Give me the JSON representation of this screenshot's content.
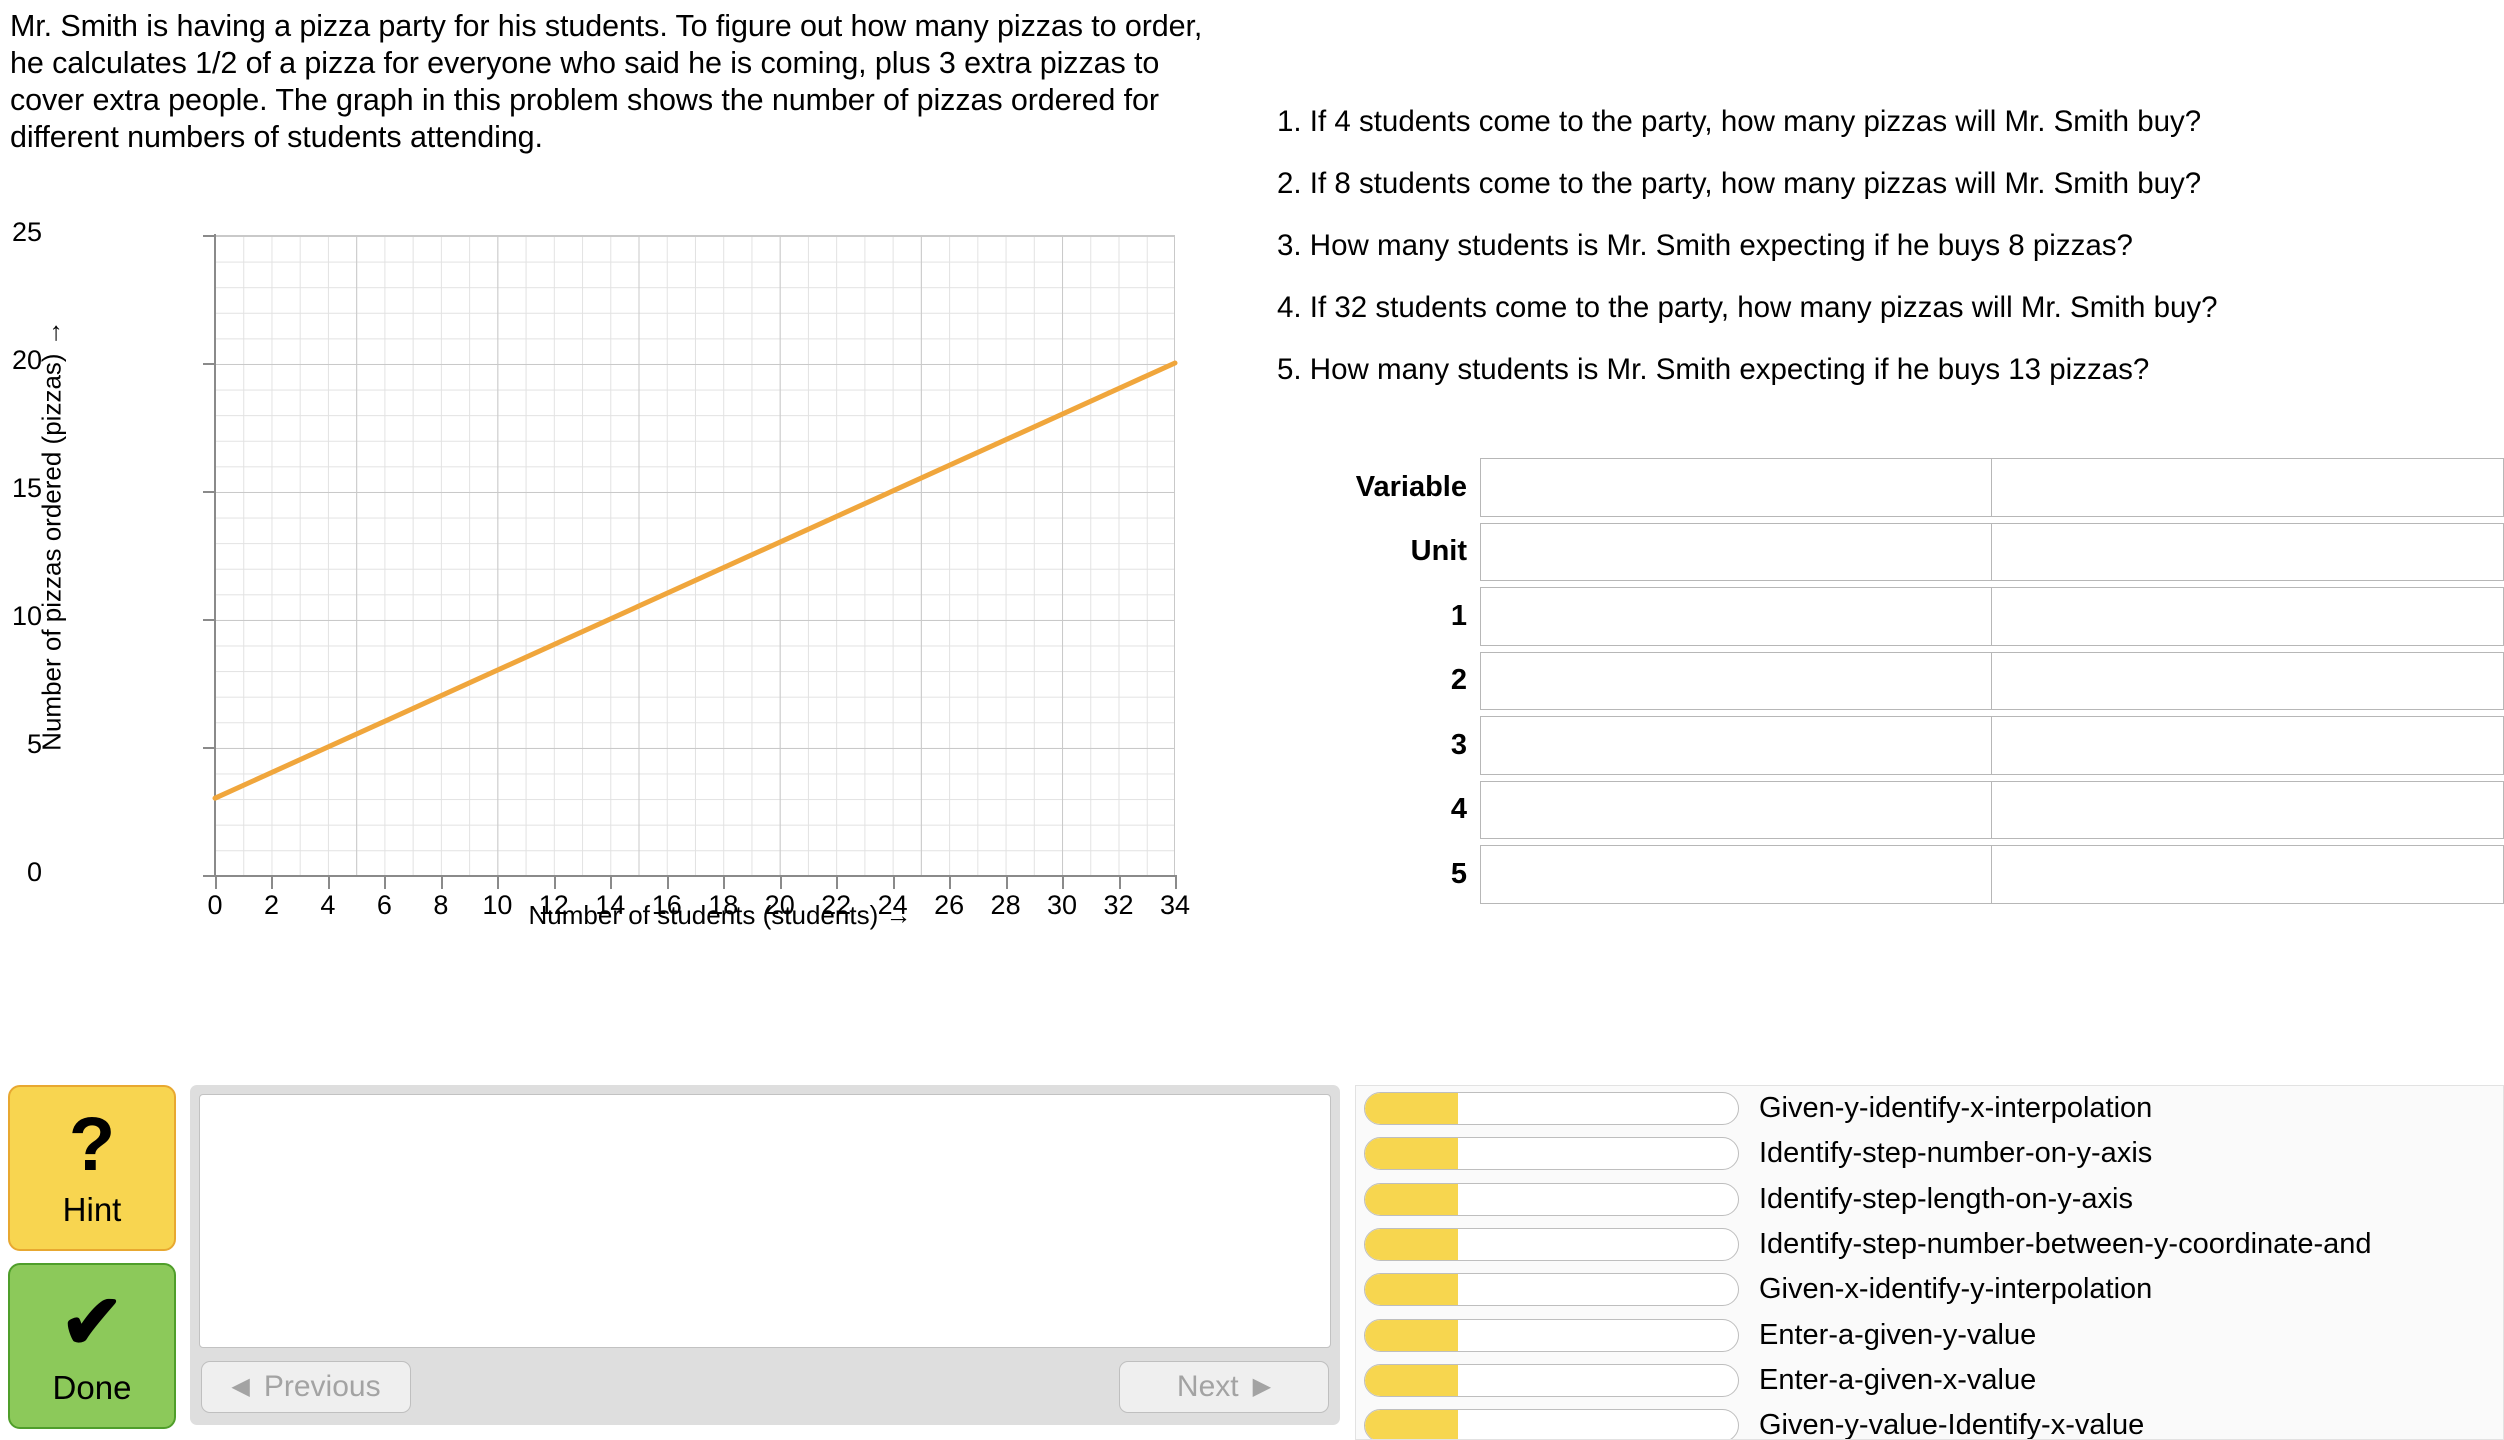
{
  "problem": {
    "statement": "Mr. Smith is having a pizza party for his students. To figure out how many pizzas to order, he calculates 1/2 of a pizza for everyone who said he is coming, plus 3 extra pizzas to cover extra people. The graph in this problem shows the number of pizzas ordered for different numbers of students attending."
  },
  "questions": [
    "1. If 4 students come to the party, how many pizzas will Mr. Smith buy?",
    "2. If 8 students come to the party, how many pizzas will Mr. Smith buy?",
    "3. How many students is Mr. Smith expecting if he buys 8 pizzas?",
    "4. If 32 students come to the party, how many pizzas will Mr. Smith buy?",
    "5. How many students is Mr. Smith expecting if he buys 13 pizzas?"
  ],
  "chart_data": {
    "type": "line",
    "title": "",
    "xlabel": "Number of students (students) →",
    "ylabel": "Number of pizzas ordered (pizzas) →",
    "xlim": [
      0,
      34
    ],
    "ylim": [
      0,
      25
    ],
    "xticks": [
      0,
      2,
      4,
      6,
      8,
      10,
      12,
      14,
      16,
      18,
      20,
      22,
      24,
      26,
      28,
      30,
      32,
      34
    ],
    "yticks": [
      0,
      5,
      10,
      15,
      20,
      25
    ],
    "x_minor_step": 1,
    "y_minor_step": 1,
    "grid": true,
    "legend": "none",
    "line_color": "#F0A63C",
    "series": [
      {
        "name": "pizzas ordered",
        "equation": "y = 0.5x + 3",
        "x": [
          0,
          34
        ],
        "values": [
          3,
          20
        ]
      }
    ]
  },
  "answer_table": {
    "rows": [
      {
        "label": "Variable"
      },
      {
        "label": "Unit"
      },
      {
        "label": "1"
      },
      {
        "label": "2"
      },
      {
        "label": "3"
      },
      {
        "label": "4"
      },
      {
        "label": "5"
      }
    ],
    "columns": [
      "",
      ""
    ]
  },
  "actions": {
    "hint": {
      "label": "Hint",
      "glyph": "?",
      "color": "#F8D550"
    },
    "done": {
      "label": "Done",
      "glyph": "✔",
      "color": "#8CC95A"
    }
  },
  "feedback": {
    "text": "",
    "previous_label": "Previous",
    "next_label": "Next",
    "previous_icon": "◀",
    "next_icon": "▶"
  },
  "skills": [
    {
      "label": "Given-y-identify-x-interpolation",
      "progress": 25
    },
    {
      "label": "Identify-step-number-on-y-axis",
      "progress": 25
    },
    {
      "label": "Identify-step-length-on-y-axis",
      "progress": 25
    },
    {
      "label": "Identify-step-number-between-y-coordinate-and",
      "progress": 25
    },
    {
      "label": "Given-x-identify-y-interpolation",
      "progress": 25
    },
    {
      "label": "Enter-a-given-y-value",
      "progress": 25
    },
    {
      "label": "Enter-a-given-x-value",
      "progress": 25
    },
    {
      "label": "Given-y-value-Identify-x-value",
      "progress": 25
    }
  ]
}
